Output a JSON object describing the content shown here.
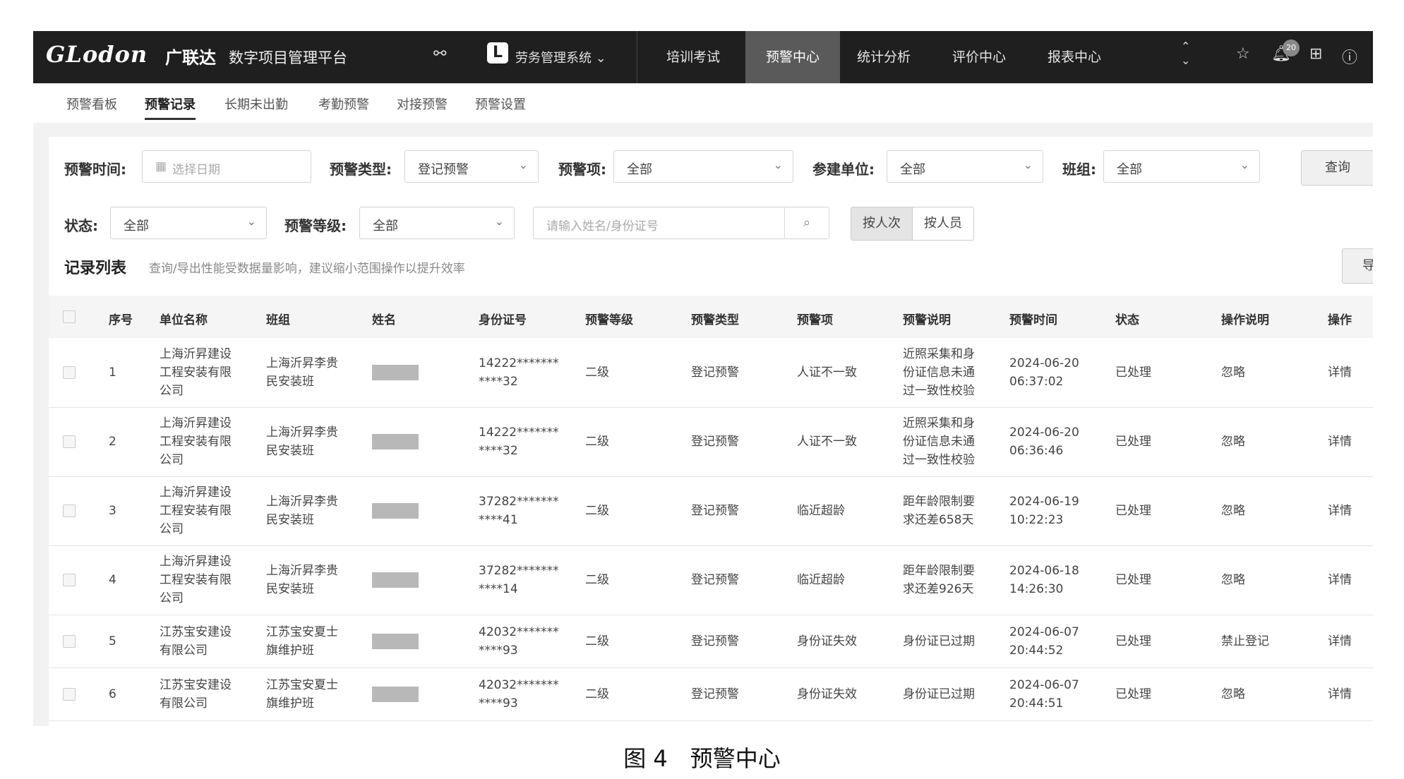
{
  "topbar": {
    "logo": "GLodon",
    "logo_cn": "广联达",
    "platform": "数字项目管理平台",
    "system_label": "劳务管理系统",
    "system_icon": "L",
    "nav": [
      {
        "label": "培训考试"
      },
      {
        "label": "预警中心"
      },
      {
        "label": "统计分析"
      },
      {
        "label": "评价中心"
      },
      {
        "label": "报表中心"
      }
    ],
    "notification_count": "20"
  },
  "subtabs": [
    {
      "label": "预警看板"
    },
    {
      "label": "预警记录"
    },
    {
      "label": "长期未出勤"
    },
    {
      "label": "考勤预警"
    },
    {
      "label": "对接预警"
    },
    {
      "label": "预警设置"
    }
  ],
  "filters": {
    "time_label": "预警时间:",
    "time_placeholder": "选择日期",
    "type_label": "预警类型:",
    "type_value": "登记预警",
    "item_label": "预警项:",
    "item_value": "全部",
    "unit_label": "参建单位:",
    "unit_value": "全部",
    "team_label": "班组:",
    "team_value": "全部",
    "query_button": "查询",
    "status_label": "状态:",
    "status_value": "全部",
    "level_label": "预警等级:",
    "level_value": "全部",
    "search_placeholder": "请输入姓名/身份证号",
    "by_count": "按人次",
    "by_person": "按人员",
    "export_button": "导"
  },
  "list": {
    "title": "记录列表",
    "hint": "查询/导出性能受数据量影响，建议缩小范围操作以提升效率",
    "columns": [
      "序号",
      "单位名称",
      "班组",
      "姓名",
      "身份证号",
      "预警等级",
      "预警类型",
      "预警项",
      "预警说明",
      "预警时间",
      "状态",
      "操作说明",
      "操作"
    ],
    "rows": [
      {
        "no": "1",
        "unit": [
          "上海沂昇建设",
          "工程安装有限",
          "公司"
        ],
        "team": [
          "上海沂昇李贵",
          "民安装班"
        ],
        "id": [
          "14222*******",
          "****32"
        ],
        "level": "二级",
        "type": "登记预警",
        "item": "人证不一致",
        "desc": [
          "近照采集和身",
          "份证信息未通",
          "过一致性校验"
        ],
        "time": [
          "2024-06-20",
          "06:37:02"
        ],
        "status": "已处理",
        "op_desc": "忽略",
        "op": "详情"
      },
      {
        "no": "2",
        "unit": [
          "上海沂昇建设",
          "工程安装有限",
          "公司"
        ],
        "team": [
          "上海沂昇李贵",
          "民安装班"
        ],
        "id": [
          "14222*******",
          "****32"
        ],
        "level": "二级",
        "type": "登记预警",
        "item": "人证不一致",
        "desc": [
          "近照采集和身",
          "份证信息未通",
          "过一致性校验"
        ],
        "time": [
          "2024-06-20",
          "06:36:46"
        ],
        "status": "已处理",
        "op_desc": "忽略",
        "op": "详情"
      },
      {
        "no": "3",
        "unit": [
          "上海沂昇建设",
          "工程安装有限",
          "公司"
        ],
        "team": [
          "上海沂昇李贵",
          "民安装班"
        ],
        "id": [
          "37282*******",
          "****41"
        ],
        "level": "二级",
        "type": "登记预警",
        "item": "临近超龄",
        "desc": [
          "距年龄限制要",
          "求还差658天"
        ],
        "time": [
          "2024-06-19",
          "10:22:23"
        ],
        "status": "已处理",
        "op_desc": "忽略",
        "op": "详情"
      },
      {
        "no": "4",
        "unit": [
          "上海沂昇建设",
          "工程安装有限",
          "公司"
        ],
        "team": [
          "上海沂昇李贵",
          "民安装班"
        ],
        "id": [
          "37282*******",
          "****14"
        ],
        "level": "二级",
        "type": "登记预警",
        "item": "临近超龄",
        "desc": [
          "距年龄限制要",
          "求还差926天"
        ],
        "time": [
          "2024-06-18",
          "14:26:30"
        ],
        "status": "已处理",
        "op_desc": "忽略",
        "op": "详情"
      },
      {
        "no": "5",
        "unit": [
          "江苏宝安建设",
          "有限公司"
        ],
        "team": [
          "江苏宝安夏士",
          "旗维护班"
        ],
        "id": [
          "42032*******",
          "****93"
        ],
        "level": "二级",
        "type": "登记预警",
        "item": "身份证失效",
        "desc": [
          "身份证已过期"
        ],
        "time": [
          "2024-06-07",
          "20:44:52"
        ],
        "status": "已处理",
        "op_desc": "禁止登记",
        "op": "详情"
      },
      {
        "no": "6",
        "unit": [
          "江苏宝安建设",
          "有限公司"
        ],
        "team": [
          "江苏宝安夏士",
          "旗维护班"
        ],
        "id": [
          "42032*******",
          "****93"
        ],
        "level": "二级",
        "type": "登记预警",
        "item": "身份证失效",
        "desc": [
          "身份证已过期"
        ],
        "time": [
          "2024-06-07",
          "20:44:51"
        ],
        "status": "已处理",
        "op_desc": "忽略",
        "op": "详情"
      }
    ]
  },
  "caption": "图 4　预警中心"
}
